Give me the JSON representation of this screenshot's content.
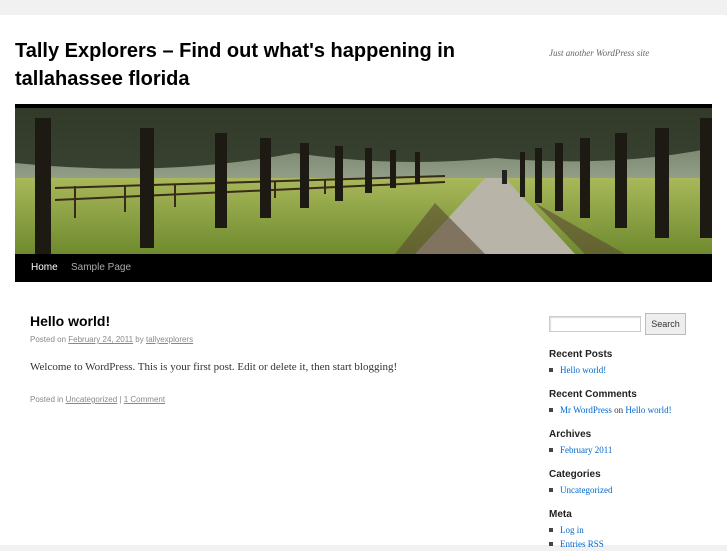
{
  "header": {
    "site_title": "Tally Explorers – Find out what's happening in tallahassee florida",
    "site_description": "Just another WordPress site"
  },
  "nav": {
    "items": [
      {
        "label": "Home",
        "current": true
      },
      {
        "label": "Sample Page",
        "current": false
      }
    ]
  },
  "post": {
    "title": "Hello world!",
    "posted_on": "Posted on",
    "date": "February 24, 2011",
    "by": "by",
    "author": "tallyexplorers",
    "content": "Welcome to WordPress. This is your first post. Edit or delete it, then start blogging!",
    "posted_in": "Posted in",
    "category": "Uncategorized",
    "separator": "|",
    "comments": "1 Comment"
  },
  "sidebar": {
    "search_button": "Search",
    "search_value": "",
    "recent_posts": {
      "title": "Recent Posts",
      "items": [
        "Hello world!"
      ]
    },
    "recent_comments": {
      "title": "Recent Comments",
      "author": "Mr WordPress",
      "on": "on",
      "post": "Hello world!"
    },
    "archives": {
      "title": "Archives",
      "items": [
        "February 2011"
      ]
    },
    "categories": {
      "title": "Categories",
      "items": [
        "Uncategorized"
      ]
    },
    "meta": {
      "title": "Meta",
      "items": [
        "Log in",
        "Entries RSS"
      ]
    }
  },
  "colors": {
    "link": "#0066cc",
    "nav_bg": "#000000",
    "page_bg": "#f1f1f1"
  }
}
